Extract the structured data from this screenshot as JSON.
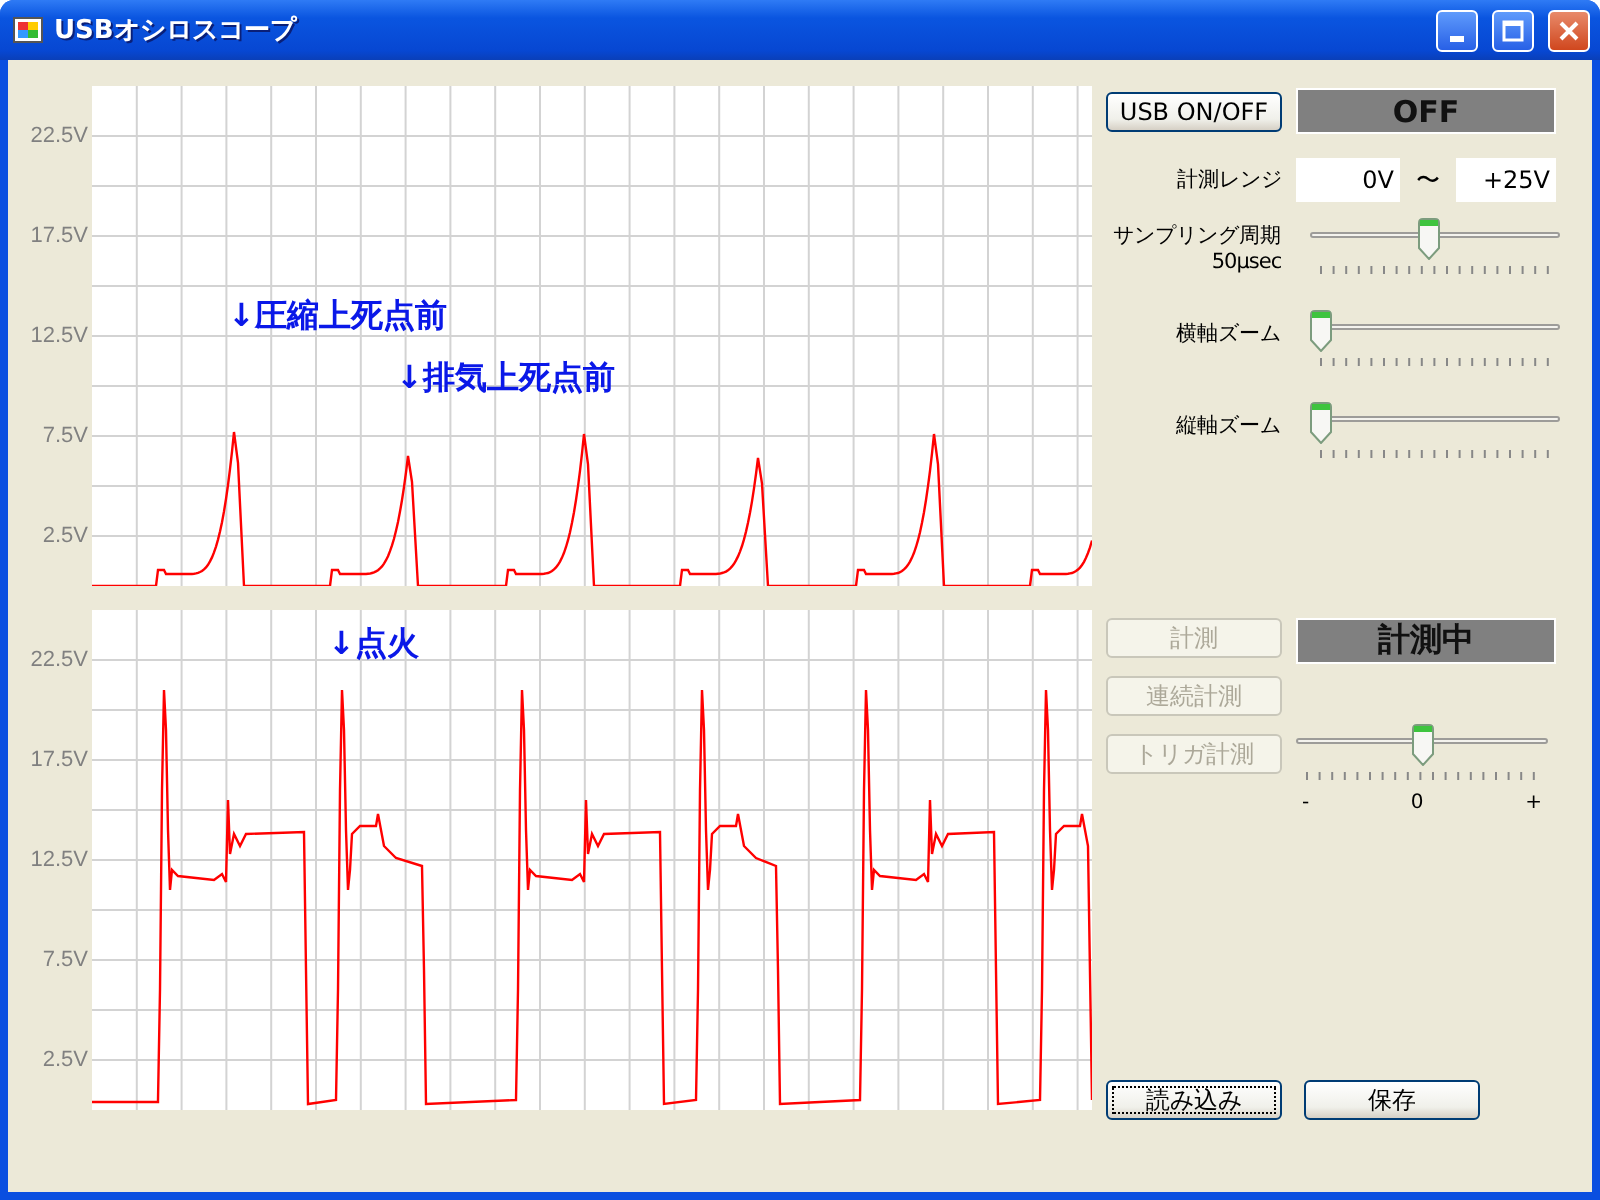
{
  "window": {
    "title": "USBオシロスコープ"
  },
  "plots": [
    {
      "y_labels": [
        "22.5V",
        "17.5V",
        "12.5V",
        "7.5V",
        "2.5V"
      ],
      "annotations": [
        "↓圧縮上死点前",
        "↓排気上死点前"
      ]
    },
    {
      "y_labels": [
        "22.5V",
        "17.5V",
        "12.5V",
        "7.5V",
        "2.5V"
      ],
      "annotations": [
        "↓点火"
      ]
    }
  ],
  "usb": {
    "button": "USB ON/OFF",
    "status": "OFF"
  },
  "range": {
    "label": "計測レンジ",
    "min": "0V",
    "separator": "〜",
    "max": "+25V"
  },
  "sliders": [
    {
      "label": "サンプリング周期",
      "sublabel": "50μsec",
      "level": 0.47
    },
    {
      "label": "横軸ズーム",
      "level": 0
    },
    {
      "label": "縦軸ズーム",
      "level": 0
    }
  ],
  "measure_buttons": [
    {
      "label": "計測",
      "disabled": true
    },
    {
      "label": "連続計測",
      "disabled": true
    },
    {
      "label": "トリガ計測",
      "disabled": true
    }
  ],
  "measure_status": "計測中",
  "trigger_slider": {
    "level": 0.5,
    "scale": [
      "-",
      "0",
      "+"
    ]
  },
  "file_buttons": [
    {
      "label": "読み込み",
      "focused": true
    },
    {
      "label": "保存",
      "focused": false
    }
  ]
}
